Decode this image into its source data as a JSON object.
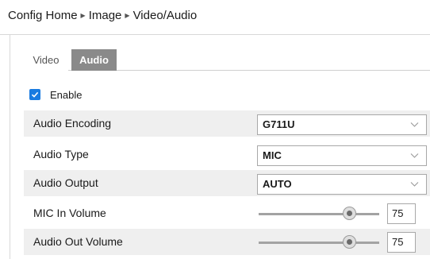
{
  "breadcrumb": {
    "items": [
      "Config Home",
      "Image",
      "Video/Audio"
    ],
    "separator": "▶"
  },
  "tabs": [
    {
      "label": "Video",
      "active": false
    },
    {
      "label": "Audio",
      "active": true
    }
  ],
  "enable": {
    "label": "Enable",
    "checked": true
  },
  "settings": [
    {
      "label": "Audio Encoding",
      "value": "G711U"
    },
    {
      "label": "Audio Type",
      "value": "MIC"
    },
    {
      "label": "Audio Output",
      "value": "AUTO"
    }
  ],
  "volumes": [
    {
      "label": "MIC In Volume",
      "value": "75",
      "level": 0.75
    },
    {
      "label": "Audio Out Volume",
      "value": "75",
      "level": 0.75
    }
  ],
  "colors": {
    "accent": "#1a7be0",
    "active_tab": "#8a8a8a",
    "row_shade": "#efefef"
  },
  "icons": {
    "chevron": "chevron-down-icon",
    "check": "check-icon"
  }
}
